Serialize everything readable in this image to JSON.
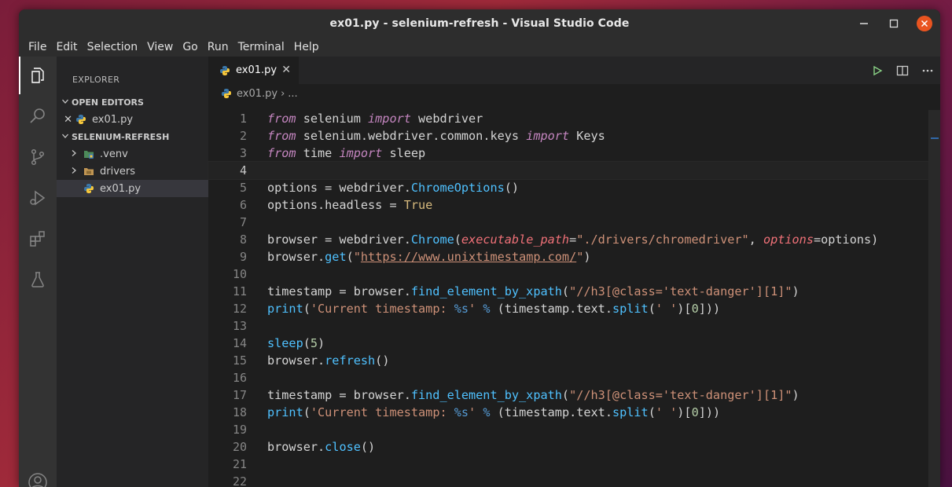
{
  "window": {
    "title": "ex01.py - selenium-refresh - Visual Studio Code",
    "controls": [
      "minimize",
      "maximize",
      "close"
    ]
  },
  "menu": [
    "File",
    "Edit",
    "Selection",
    "View",
    "Go",
    "Run",
    "Terminal",
    "Help"
  ],
  "activity_bar": [
    "explorer-icon",
    "search-icon",
    "source-control-icon",
    "run-debug-icon",
    "extensions-icon",
    "testing-icon",
    "accounts-icon"
  ],
  "sidebar": {
    "title": "EXPLORER",
    "open_editors": {
      "label": "OPEN EDITORS",
      "items": [
        {
          "name": "ex01.py"
        }
      ]
    },
    "folder": {
      "label": "SELENIUM-REFRESH",
      "items": [
        {
          "name": ".venv",
          "type": "folder"
        },
        {
          "name": "drivers",
          "type": "folder"
        },
        {
          "name": "ex01.py",
          "type": "file",
          "selected": true
        }
      ]
    }
  },
  "tab": {
    "label": "ex01.py"
  },
  "breadcrumb": {
    "file": "ex01.py",
    "sep": "›",
    "more": "..."
  },
  "code": {
    "line_numbers": [
      "1",
      "2",
      "3",
      "4",
      "5",
      "6",
      "7",
      "8",
      "9",
      "10",
      "11",
      "12",
      "13",
      "14",
      "15",
      "16",
      "17",
      "18",
      "19",
      "20",
      "21",
      "22"
    ],
    "lines": [
      "from selenium import webdriver",
      "from selenium.webdriver.common.keys import Keys",
      "from time import sleep",
      "",
      "options = webdriver.ChromeOptions()",
      "options.headless = True",
      "",
      "browser = webdriver.Chrome(executable_path=\"./drivers/chromedriver\", options=options)",
      "browser.get(\"https://www.unixtimestamp.com/\")",
      "",
      "timestamp = browser.find_element_by_xpath(\"//h3[@class='text-danger'][1]\")",
      "print('Current timestamp: %s' % (timestamp.text.split(' ')[0]))",
      "",
      "sleep(5)",
      "browser.refresh()",
      "",
      "timestamp = browser.find_element_by_xpath(\"//h3[@class='text-danger'][1]\")",
      "print('Current timestamp: %s' % (timestamp.text.split(' ')[0]))",
      "",
      "browser.close()",
      "",
      ""
    ],
    "current_line": 4
  },
  "colors": {
    "keyword": "#c586c0",
    "function": "#4fc1ff",
    "string": "#ce9178",
    "parameter": "#f07178",
    "constant": "#569cd6",
    "number": "#b5cea8",
    "text": "#d4d4d4",
    "close_button": "#e95420"
  }
}
